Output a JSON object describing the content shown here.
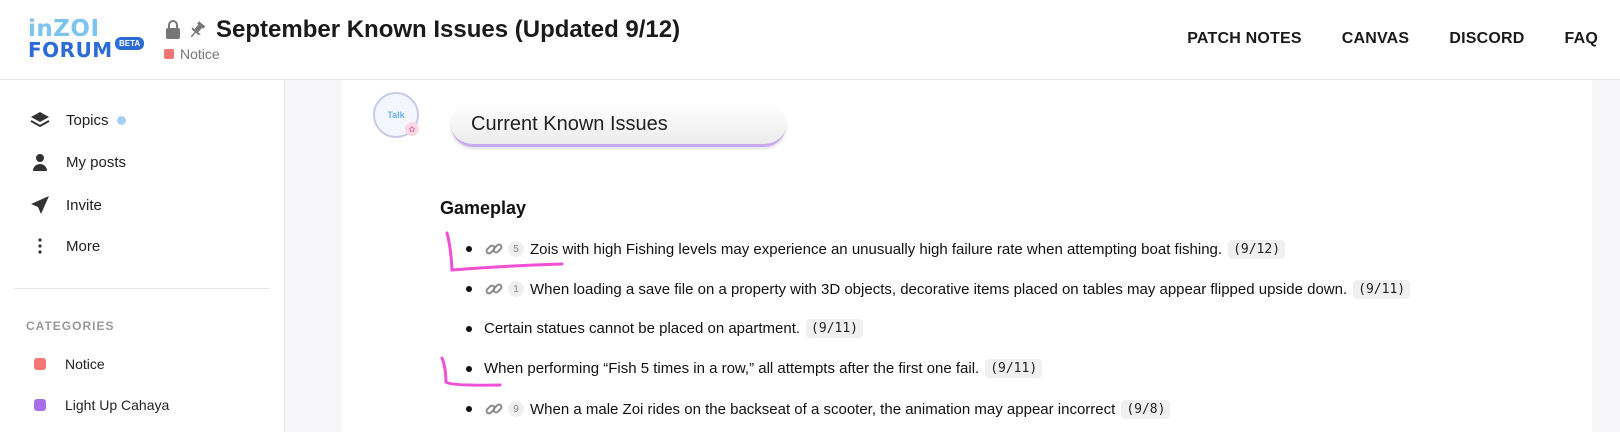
{
  "header": {
    "logo_top": "inZOI",
    "logo_bottom": "FORUM",
    "logo_badge": "BETA",
    "title": "September Known Issues (Updated 9/12)",
    "category": "Notice",
    "nav": [
      "PATCH NOTES",
      "CANVAS",
      "DISCORD",
      "FAQ"
    ]
  },
  "sidebar": {
    "items": [
      {
        "label": "Topics",
        "icon": "layers-icon"
      },
      {
        "label": "My posts",
        "icon": "user-icon"
      },
      {
        "label": "Invite",
        "icon": "paper-plane-icon"
      },
      {
        "label": "More",
        "icon": "vertical-dots-icon"
      }
    ],
    "categories_header": "CATEGORIES",
    "categories": [
      {
        "label": "Notice",
        "color": "#f47575"
      },
      {
        "label": "Light Up Cahaya",
        "color": "#a86ee6"
      }
    ]
  },
  "post": {
    "avatar_label": "Talk",
    "banner": "Current Known Issues",
    "section": "Gameplay",
    "issues": [
      {
        "has_link": true,
        "count": "5",
        "text": "Zois with high Fishing levels may experience an unusually high failure rate when attempting boat fishing.",
        "date": "(9/12)"
      },
      {
        "has_link": true,
        "count": "1",
        "text": "When loading a save file on a property with 3D objects, decorative items placed on tables may appear flipped upside down.",
        "date": "(9/11)"
      },
      {
        "has_link": false,
        "count": "",
        "text": "Certain statues cannot be placed on apartment.",
        "date": "(9/11)"
      },
      {
        "has_link": false,
        "count": "",
        "text": "When performing “Fish 5 times in a row,” all attempts after the first one fail.",
        "date": "(9/11)"
      },
      {
        "has_link": true,
        "count": "9",
        "text": "When a male Zoi rides on the backseat of a scooter, the animation may appear incorrect",
        "date": "(9/8)"
      }
    ]
  },
  "colors": {
    "accent": "#2d6bd8",
    "annotation": "#f04fd6"
  }
}
